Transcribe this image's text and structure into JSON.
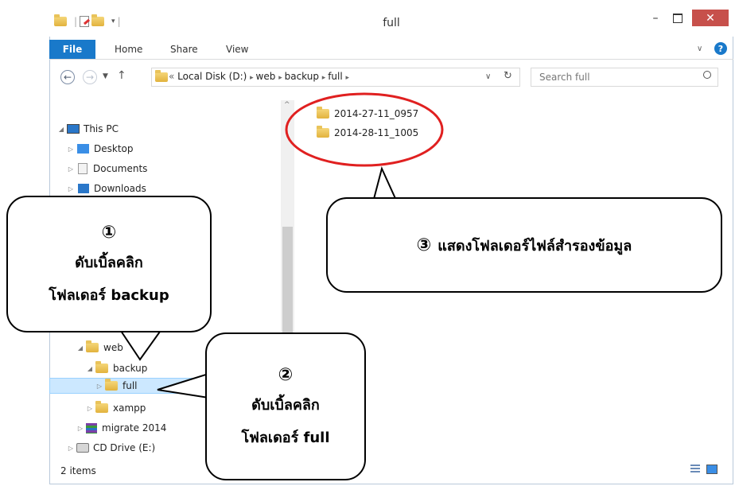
{
  "window": {
    "title": "full"
  },
  "ribbon": {
    "tabs": [
      "File",
      "Home",
      "Share",
      "View"
    ]
  },
  "address": {
    "breadcrumb": [
      "Local Disk (D:)",
      "web",
      "backup",
      "full"
    ]
  },
  "search": {
    "placeholder": "Search full"
  },
  "nav_tree": [
    {
      "label": "This PC",
      "icon": "pc-icon",
      "expanded": true
    },
    {
      "label": "Desktop",
      "icon": "desktop-icon"
    },
    {
      "label": "Documents",
      "icon": "documents-icon"
    },
    {
      "label": "Downloads",
      "icon": "downloads-icon"
    },
    {
      "label": "web",
      "icon": "folder-icon",
      "expanded": true
    },
    {
      "label": "backup",
      "icon": "folder-icon",
      "expanded": true
    },
    {
      "label": "full",
      "icon": "folder-icon",
      "selected": true
    },
    {
      "label": "xampp",
      "icon": "folder-icon"
    },
    {
      "label": "migrate 2014",
      "icon": "archive-icon"
    },
    {
      "label": "CD Drive (E:)",
      "icon": "cd-drive-icon"
    }
  ],
  "content": {
    "items": [
      "2014-27-11_0957",
      "2014-28-11_1005"
    ]
  },
  "status": {
    "count": "2 items"
  },
  "callouts": [
    {
      "number": "①",
      "lines": [
        "ดับเบิ้ลคลิก",
        "โฟลเดอร์ backup"
      ]
    },
    {
      "number": "②",
      "lines": [
        "ดับเบิ้ลคลิก",
        "โฟลเดอร์ full"
      ]
    },
    {
      "number": "③",
      "text": "แสดงโฟลเดอร์ไฟล์สำรองข้อมูล"
    }
  ],
  "colors": {
    "file_tab": "#1979ca",
    "selection": "#cce8ff",
    "close_button": "#c7504b",
    "annotation_circle": "#e02020"
  }
}
